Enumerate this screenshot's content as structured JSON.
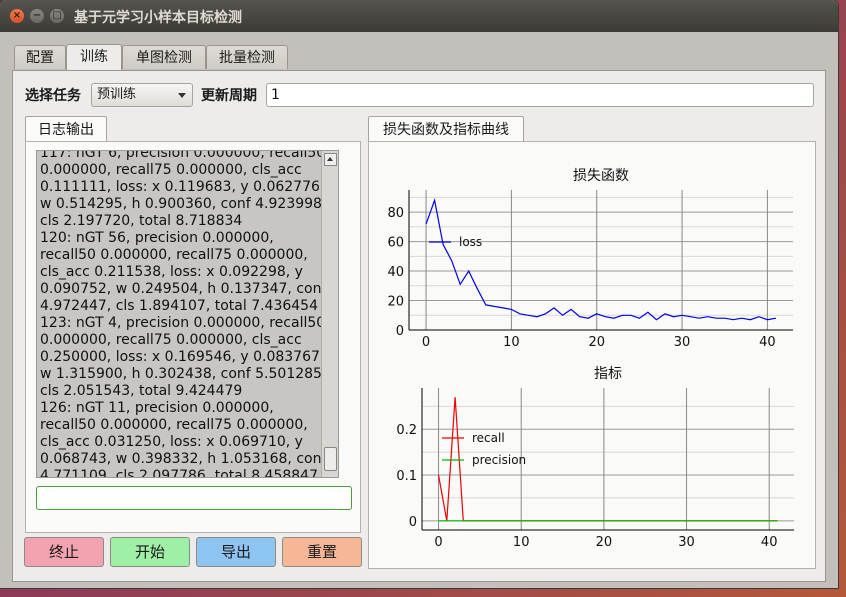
{
  "window": {
    "title": "基于元学习小样本目标检测"
  },
  "tabs": [
    {
      "label": "配置"
    },
    {
      "label": "训练"
    },
    {
      "label": "单图检测"
    },
    {
      "label": "批量检测"
    }
  ],
  "toolbar": {
    "task_label": "选择任务",
    "task_value": "预训练",
    "period_label": "更新周期",
    "period_value": "1"
  },
  "log": {
    "tab_label": "日志输出",
    "text": "117: nGT 6, precision 0.000000, recall50 0.000000, recall75 0.000000, cls_acc 0.111111, loss: x 0.119683, y 0.062776, w 0.514295, h 0.900360, conf 4.923998, cls 2.197720, total 8.718834\n120: nGT 56, precision 0.000000, recall50 0.000000, recall75 0.000000, cls_acc 0.211538, loss: x 0.092298, y 0.090752, w 0.249504, h 0.137347, conf 4.972447, cls 1.894107, total 7.436454\n123: nGT 4, precision 0.000000, recall50 0.000000, recall75 0.000000, cls_acc 0.250000, loss: x 0.169546, y 0.083767, w 1.315900, h 0.302438, conf 5.501285, cls 2.051543, total 9.424479\n126: nGT 11, precision 0.000000, recall50 0.000000, recall75 0.000000, cls_acc 0.031250, loss: x 0.069710, y 0.068743, w 0.398332, h 1.053168, conf 4.771109, cls 2.097786, total 8.458847",
    "input_value": ""
  },
  "buttons": {
    "stop": "终止",
    "start": "开始",
    "export": "导出",
    "reset": "重置"
  },
  "charts": {
    "tab_label": "损失函数及指标曲线"
  },
  "colors": {
    "stop": "#f3a2b0",
    "start": "#9ef0a6",
    "export": "#8ec4f2",
    "reset": "#f6b796",
    "loss": "#0000ee",
    "recall": "#ee0000",
    "precision": "#00bb00"
  },
  "chart_data": [
    {
      "type": "line",
      "title": "损失函数",
      "xlim": [
        -2,
        43
      ],
      "ylim": [
        0,
        95
      ],
      "xticks": [
        0,
        10,
        20,
        30,
        40
      ],
      "yticks": [
        0,
        20,
        40,
        60,
        80
      ],
      "grid": true,
      "legend_position": "upper-left",
      "series": [
        {
          "name": "loss",
          "x": [
            0,
            1,
            2,
            3,
            4,
            5,
            6,
            7,
            8,
            9,
            10,
            11,
            12,
            13,
            14,
            15,
            16,
            17,
            18,
            19,
            20,
            21,
            22,
            23,
            24,
            25,
            26,
            27,
            28,
            29,
            30,
            31,
            32,
            33,
            34,
            35,
            36,
            37,
            38,
            39,
            40,
            41
          ],
          "values": [
            72,
            88,
            58,
            47,
            31,
            40,
            28,
            17,
            16,
            15,
            14,
            11,
            10,
            9,
            11,
            15,
            10,
            14,
            9,
            8,
            11,
            9,
            8,
            10,
            10,
            8,
            12,
            7,
            11,
            9,
            10,
            9,
            8,
            9,
            8,
            8,
            7,
            8,
            7,
            9,
            7,
            8
          ]
        }
      ]
    },
    {
      "type": "line",
      "title": "指标",
      "xlim": [
        -2,
        43
      ],
      "ylim": [
        -0.02,
        0.29
      ],
      "xticks": [
        0,
        10,
        20,
        30,
        40
      ],
      "yticks": [
        0,
        0.1,
        0.2
      ],
      "grid": true,
      "legend_position": "upper-left",
      "series": [
        {
          "name": "recall",
          "x": [
            0,
            1,
            2,
            3,
            4,
            5,
            10,
            20,
            30,
            41
          ],
          "values": [
            0.1,
            0,
            0.27,
            0,
            0,
            0,
            0,
            0,
            0,
            0
          ]
        },
        {
          "name": "precision",
          "x": [
            0,
            41
          ],
          "values": [
            0,
            0
          ]
        }
      ]
    }
  ]
}
